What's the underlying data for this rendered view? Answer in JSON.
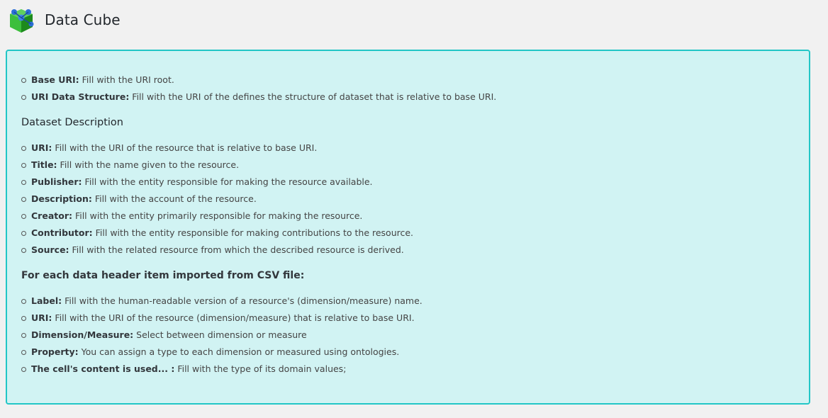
{
  "header": {
    "title": "Data Cube",
    "logo_icon": "data-cube-logo-icon"
  },
  "colors": {
    "background": "#f1f1f1",
    "panel_bg": "#d1f3f3",
    "panel_border": "#22c6c6"
  },
  "uri_section": {
    "items": [
      {
        "term": "Base URI:",
        "text": " Fill with the URI root."
      },
      {
        "term": "URI Data Structure:",
        "text": " Fill with the URI of the defines the structure of dataset that is relative to base URI."
      }
    ]
  },
  "dataset_section": {
    "heading": "Dataset Description",
    "items": [
      {
        "term": "URI:",
        "text": " Fill with the URI of the resource that is relative to base URI."
      },
      {
        "term": "Title:",
        "text": " Fill with the name given to the resource."
      },
      {
        "term": "Publisher:",
        "text": " Fill with the entity responsible for making the resource available."
      },
      {
        "term": "Description:",
        "text": " Fill with the account of the resource."
      },
      {
        "term": "Creator:",
        "text": " Fill with the entity primarily responsible for making the resource."
      },
      {
        "term": "Contributor:",
        "text": " Fill with the entity responsible for making contributions to the resource."
      },
      {
        "term": "Source:",
        "text": " Fill with the related resource from which the described resource is derived."
      }
    ]
  },
  "csv_section": {
    "heading": "For each data header item imported from CSV file:",
    "items": [
      {
        "term": "Label:",
        "text": " Fill with the human-readable version of a resource's (dimension/measure) name."
      },
      {
        "term": "URI:",
        "text": " Fill with the URI of the resource (dimension/measure) that is relative to base URI."
      },
      {
        "term": "Dimension/Measure:",
        "text": " Select between dimension or measure"
      },
      {
        "term": "Property:",
        "text": " You can assign a type to each dimension or measured using ontologies."
      },
      {
        "term": "The cell's content is used... :",
        "text": " Fill with the type of its domain values;"
      }
    ]
  }
}
